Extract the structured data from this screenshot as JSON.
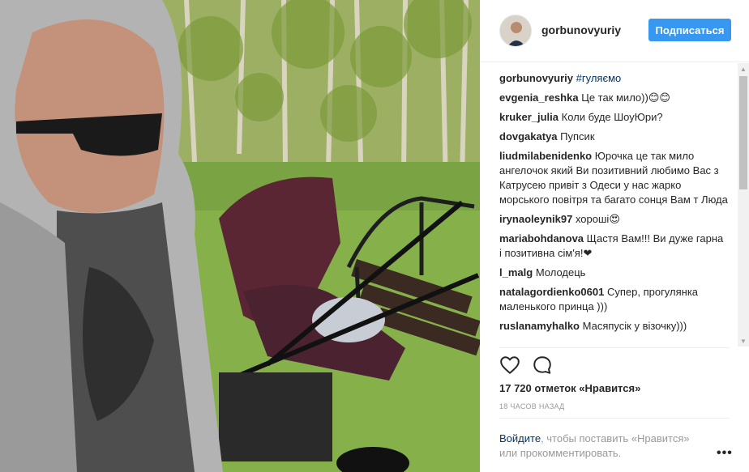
{
  "post": {
    "photo_alt": "selfie with stroller in park",
    "header": {
      "username": "gorbunovyuriy",
      "follow_label": "Подписаться"
    },
    "caption": {
      "username": "gorbunovyuriy",
      "text": "#гуляємо"
    },
    "comments": [
      {
        "user": "evgenia_reshka",
        "text": "Це так мило))😊😊"
      },
      {
        "user": "kruker_julia",
        "text": "Коли буде ШоуЮри?"
      },
      {
        "user": "dovgakatya",
        "text": "Пупсик"
      },
      {
        "user": "liudmilabenidenko",
        "text": "Юрочка це так мило ангелочок який Ви позитивний любимо Вас з Катрусею привіт з Одеси у нас жарко морського повітря та багато сонця Вам т Люда"
      },
      {
        "user": "irynaoleynik97",
        "text": "хороші😍"
      },
      {
        "user": "mariabohdanova",
        "text": "Щастя Вам!!! Ви дуже гарна і позитивна сім'я!❤"
      },
      {
        "user": "l_malg",
        "text": "Молодець"
      },
      {
        "user": "natalagordienko0601",
        "text": "Супер, прогулянка маленького принца )))"
      },
      {
        "user": "ruslanamyhalko",
        "text": "Масяпусік у візочку)))"
      }
    ],
    "actions": {
      "like_icon": "heart-icon",
      "comment_icon": "comment-icon"
    },
    "likes_text": "17 720 отметок «Нравится»",
    "timestamp": "18 ЧАСОВ НАЗАД",
    "login": {
      "link_text": "Войдите",
      "rest_text": ", чтобы поставить «Нравится» или прокомментировать."
    },
    "more_icon": "more-options-icon",
    "colors": {
      "accent": "#3897f0",
      "link": "#003569",
      "muted": "#999999"
    }
  }
}
